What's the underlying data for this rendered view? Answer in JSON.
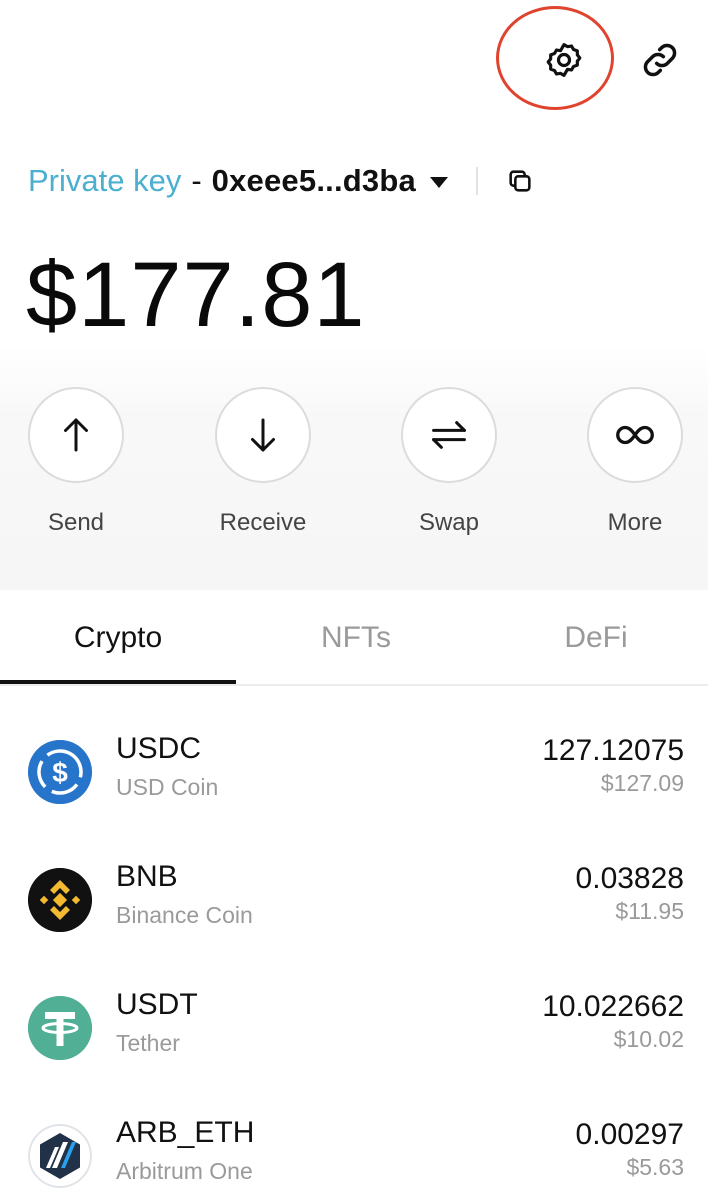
{
  "header": {
    "settings_icon": "gear-icon",
    "link_icon": "link-icon"
  },
  "account": {
    "type_label": "Private key",
    "separator": "-",
    "address": "0xeee5...d3ba",
    "dropdown_icon": "caret-down-icon",
    "copy_icon": "copy-icon"
  },
  "balance": "$177.81",
  "actions": [
    {
      "label": "Send",
      "icon": "arrow-up-icon"
    },
    {
      "label": "Receive",
      "icon": "arrow-down-icon"
    },
    {
      "label": "Swap",
      "icon": "swap-icon"
    },
    {
      "label": "More",
      "icon": "infinity-icon"
    }
  ],
  "tabs": [
    {
      "label": "Crypto",
      "active": true
    },
    {
      "label": "NFTs",
      "active": false
    },
    {
      "label": "DeFi",
      "active": false
    }
  ],
  "tokens": [
    {
      "symbol": "USDC",
      "name": "USD Coin",
      "amount": "127.12075",
      "usd": "$127.09",
      "logo_color": "#2775ca"
    },
    {
      "symbol": "BNB",
      "name": "Binance Coin",
      "amount": "0.03828",
      "usd": "$11.95",
      "logo_color": "#f3ba2f"
    },
    {
      "symbol": "USDT",
      "name": "Tether",
      "amount": "10.022662",
      "usd": "$10.02",
      "logo_color": "#50af95"
    },
    {
      "symbol": "ARB_ETH",
      "name": "Arbitrum One",
      "amount": "0.00297",
      "usd": "$5.63",
      "logo_color": "#213147"
    }
  ],
  "colors": {
    "accent": "#4bafd0",
    "highlight_ring": "#e0432e"
  }
}
